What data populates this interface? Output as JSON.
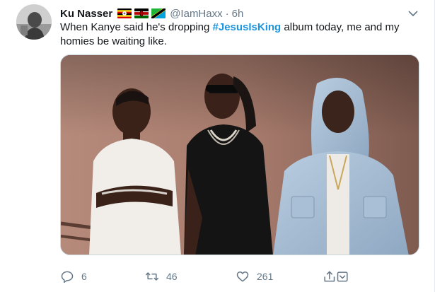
{
  "tweet": {
    "author_name": "Ku Nasser",
    "author_handle": "@IamHaxx",
    "separator": "·",
    "timestamp": "6h",
    "flags": [
      "uganda-flag",
      "kenya-flag",
      "tanzania-flag"
    ],
    "text_before": "When Kanye said he's dropping ",
    "hashtag": "#JesusIsKing",
    "text_after": " album today, me and my homies be waiting like.",
    "media_description_icon": "photo",
    "colors": {
      "link": "#1b95e0",
      "muted": "#657786",
      "text": "#14171a"
    }
  },
  "actions": {
    "reply": {
      "icon": "reply-icon",
      "count": "6"
    },
    "retweet": {
      "icon": "retweet-icon",
      "count": "46"
    },
    "like": {
      "icon": "heart-icon",
      "count": "261"
    },
    "share": {
      "icon": "share-icon"
    }
  }
}
